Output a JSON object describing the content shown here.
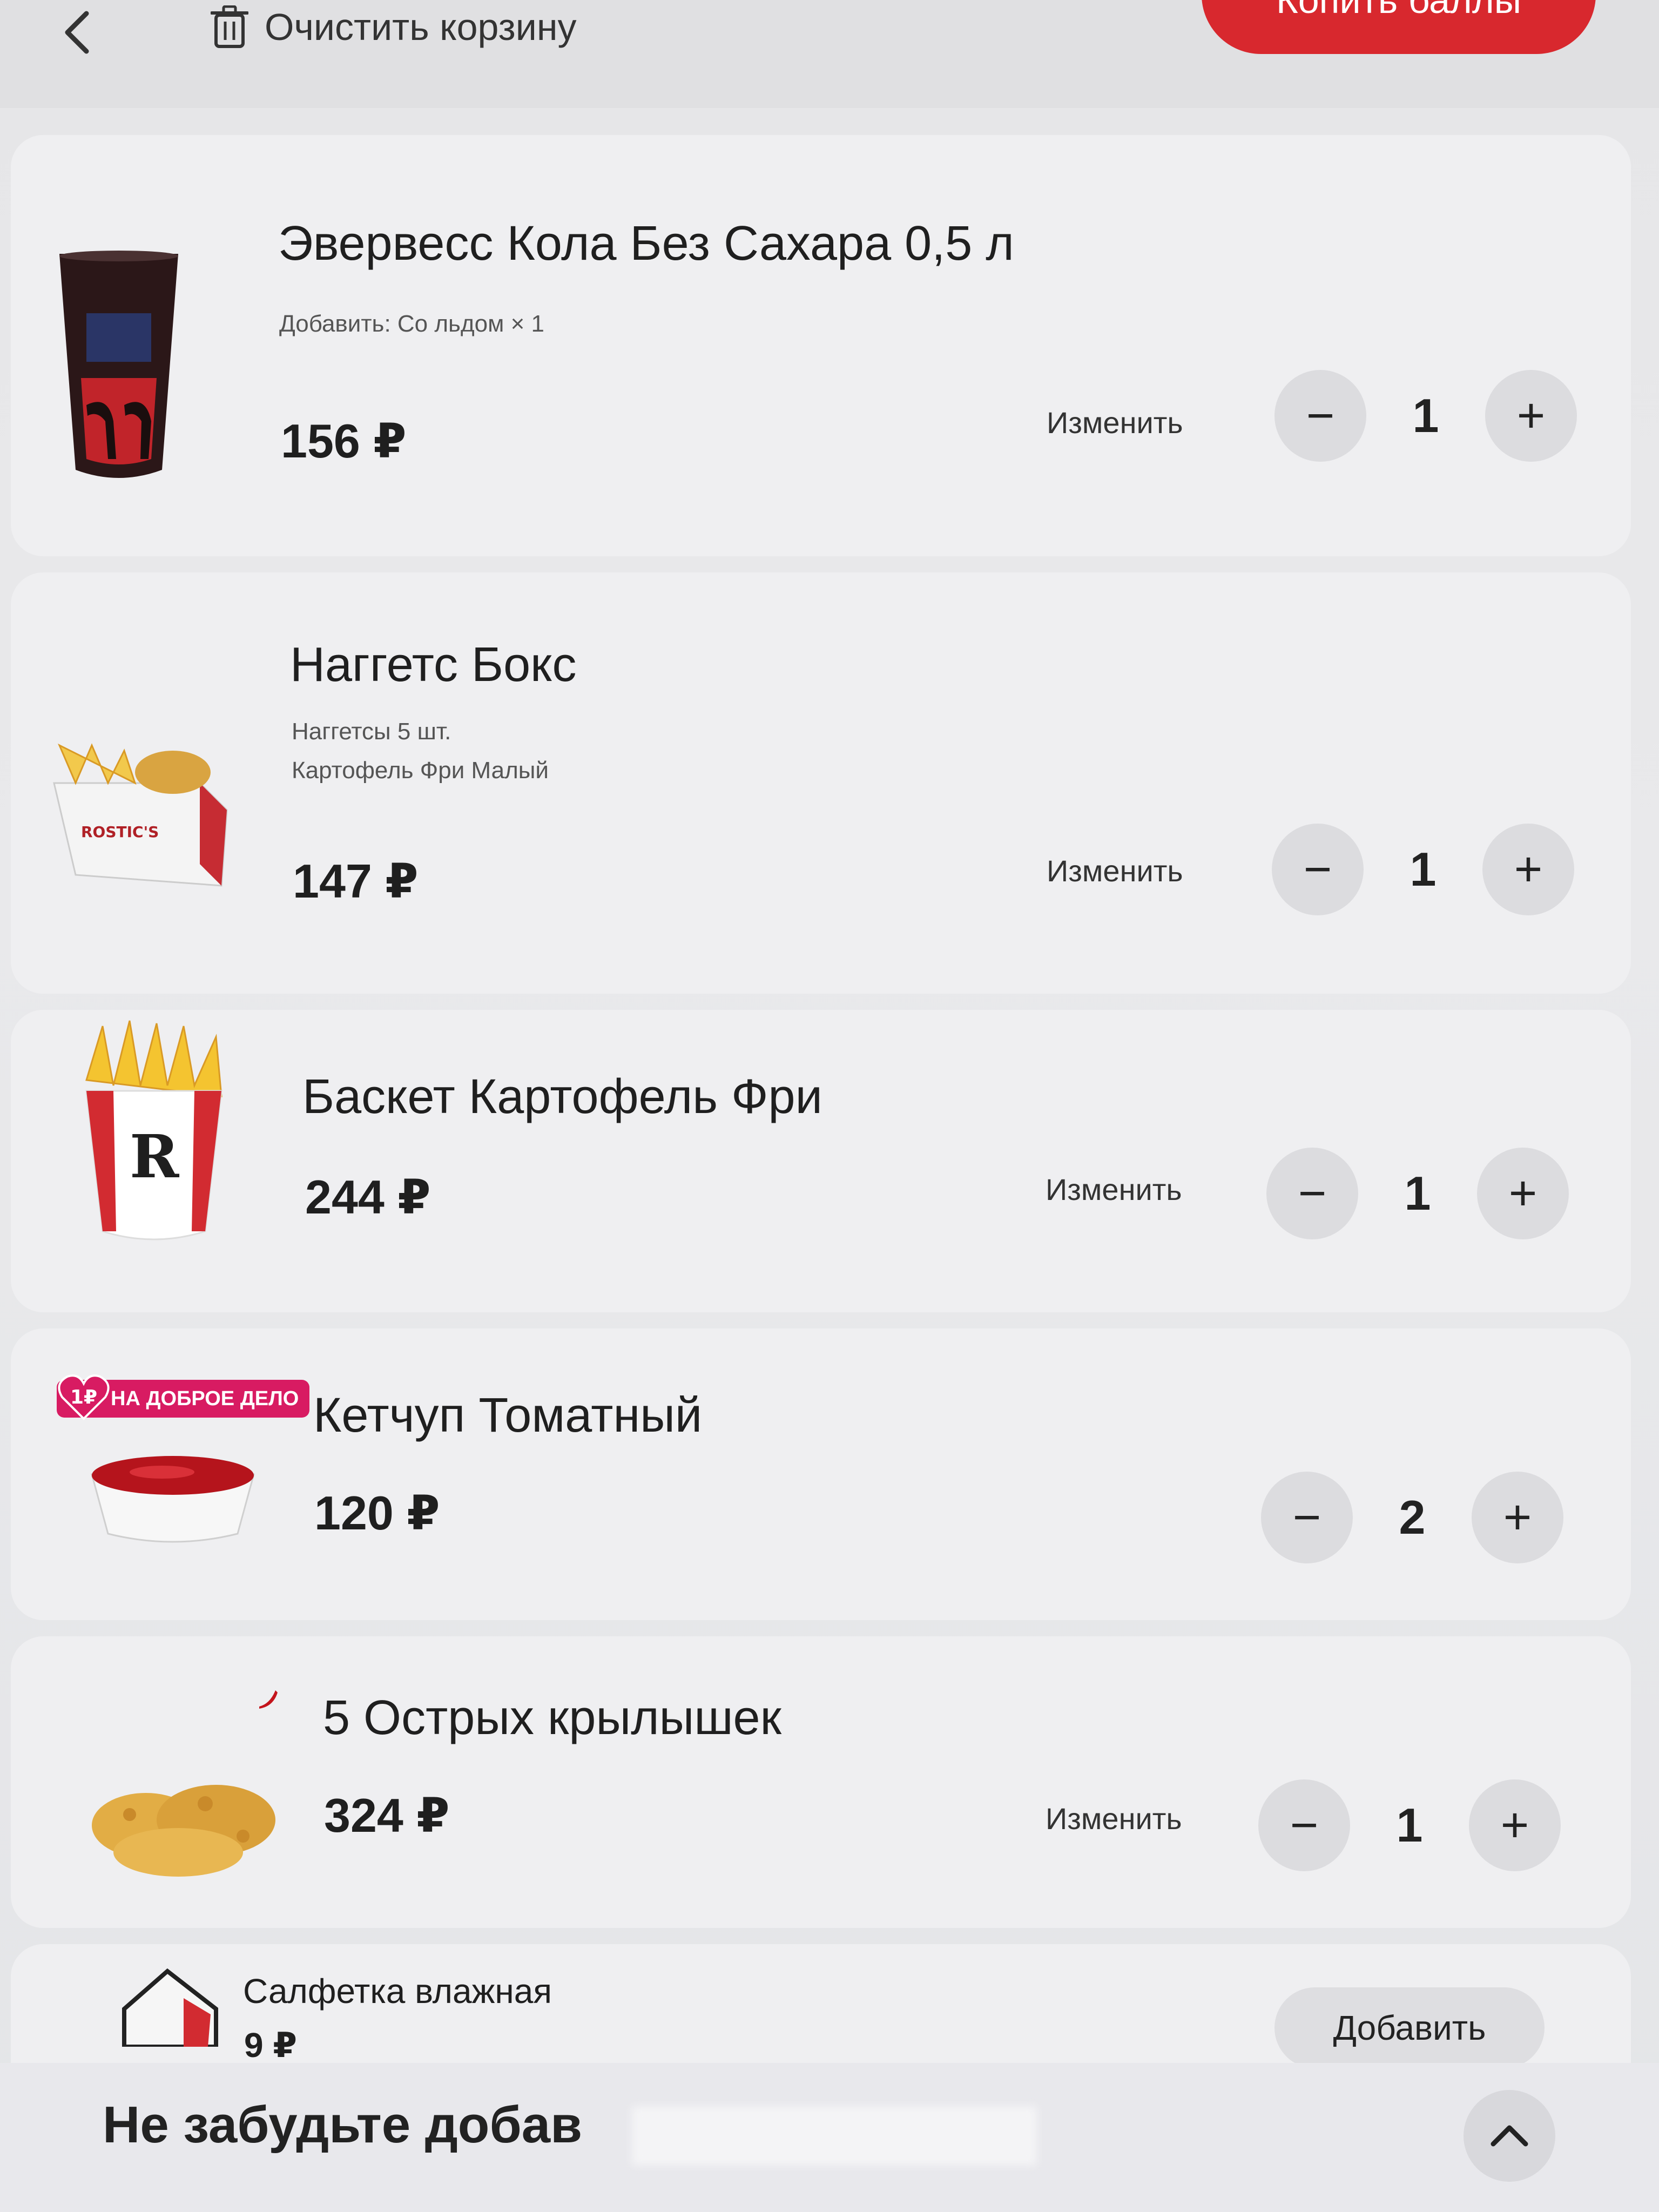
{
  "header": {
    "clear_label": "Очистить корзину",
    "pay_label": "Копить баллы"
  },
  "items": [
    {
      "title": "Эвервесс Кола Без Сахара 0,5 л",
      "details": [
        "Добавить: Со льдом × 1"
      ],
      "price": "156 ₽",
      "change_label": "Изменить",
      "qty": "1"
    },
    {
      "title": "Наггетс Бокс",
      "details": [
        "Наггетсы 5 шт.",
        "Картофель Фри Малый"
      ],
      "price": "147 ₽",
      "change_label": "Изменить",
      "qty": "1"
    },
    {
      "title": "Баскет Картофель Фри",
      "details": [],
      "price": "244 ₽",
      "change_label": "Изменить",
      "qty": "1"
    },
    {
      "title": "Кетчуп Томатный",
      "details": [],
      "price": "120 ₽",
      "change_label": "",
      "qty": "2",
      "promo": {
        "amount": "1₽",
        "text": "НА ДОБРОЕ ДЕЛО"
      }
    },
    {
      "title": "5 Острых крылышек",
      "details": [],
      "price": "324 ₽",
      "change_label": "Изменить",
      "qty": "1"
    }
  ],
  "addon": {
    "title": "Салфетка влажная",
    "price": "9 ₽",
    "add_label": "Добавить"
  },
  "footer": {
    "text": "Не забудьте добав"
  },
  "icons": {
    "back": "chevron-left-icon",
    "clear": "trash-icon",
    "minus": "minus-icon",
    "plus": "plus-icon",
    "expand": "chevron-up-icon"
  },
  "colors": {
    "accent": "#d8282e",
    "promo": "#d81b62",
    "background": "#e9e9eb",
    "card": "#efeff1",
    "control": "#dcdcdf"
  }
}
